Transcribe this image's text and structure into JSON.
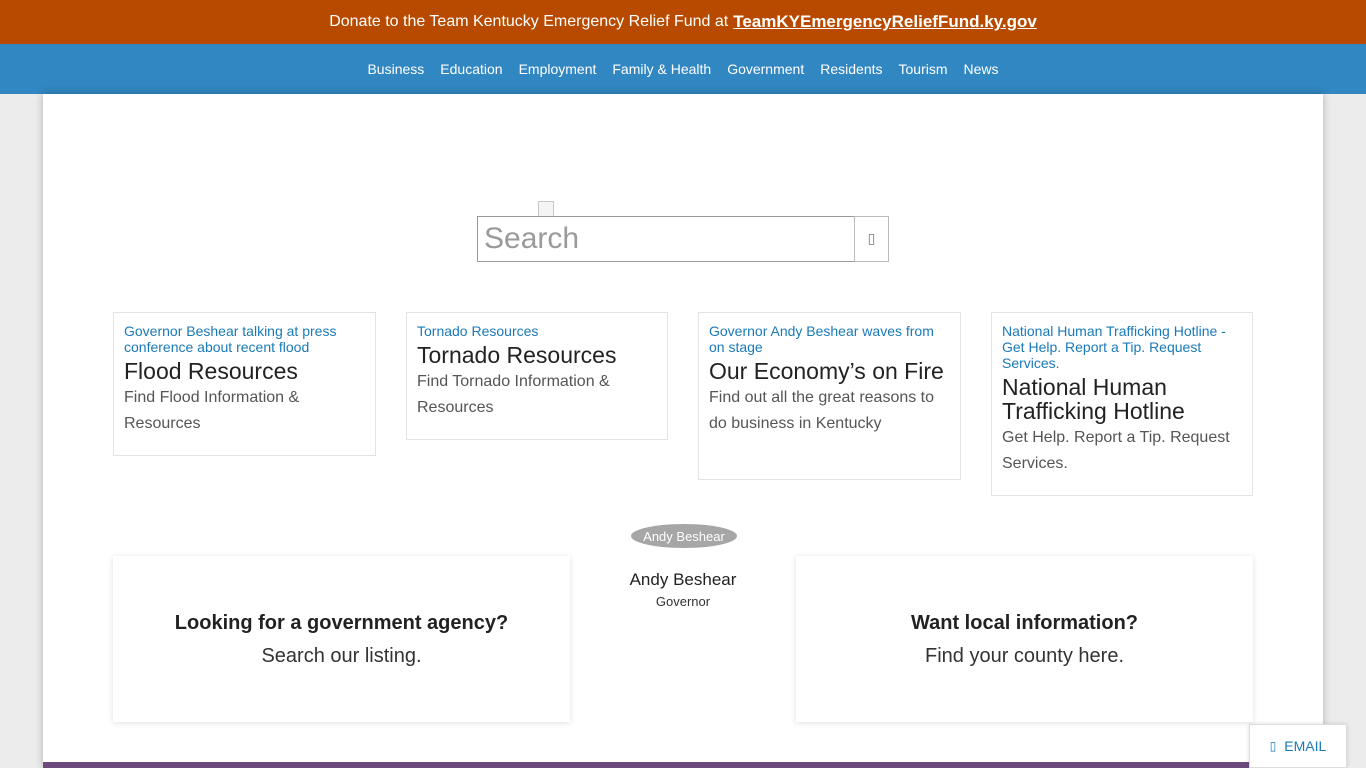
{
  "banner": {
    "text": "Donate to the Team Kentucky Emergency Relief Fund at",
    "link": "TeamKYEmergencyReliefFund.ky.gov"
  },
  "nav": {
    "items": [
      "Business",
      "Education",
      "Employment",
      "Family & Health",
      "Government",
      "Residents",
      "Tourism",
      "News"
    ]
  },
  "search": {
    "placeholder": "Search",
    "button_icon": "search-icon",
    "button_glyph": "▯"
  },
  "cards": [
    {
      "img_alt": "Governor Beshear talking at press conference about recent flood",
      "title": "Flood Resources",
      "desc": "Find Flood Information & Resources"
    },
    {
      "img_alt": "Tornado Resources",
      "title": "Tornado Resources",
      "desc": "Find Tornado Information & Resources"
    },
    {
      "img_alt": "Governor Andy Beshear waves from on stage",
      "title": "Our Economy’s on Fire",
      "desc": "Find out all the great reasons to do business in Kentucky"
    },
    {
      "img_alt": "National Human Trafficking Hotline - Get Help. Report a Tip. Request Services.",
      "title": "National Human Trafficking Hotline",
      "desc": "Get Help. Report a Tip. Request Services."
    }
  ],
  "governor": {
    "img_alt": "Andy Beshear",
    "name": "Andy Beshear",
    "title": "Governor"
  },
  "agency": {
    "heading": "Looking for a government agency?",
    "sub": "Search our listing."
  },
  "local": {
    "heading": "Want local information?",
    "sub": "Find your county here."
  },
  "email_button": {
    "label": "EMAIL",
    "icon": "envelope-icon",
    "glyph": "▯"
  }
}
